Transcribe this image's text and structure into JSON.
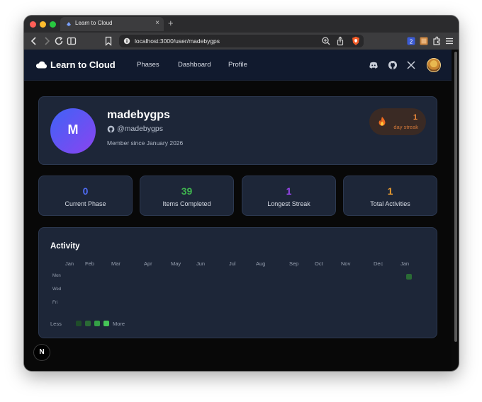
{
  "browser": {
    "tab_title": "Learn to Cloud",
    "tab_close": "×",
    "new_tab": "+",
    "url": "localhost:3000/user/madebygps"
  },
  "nav": {
    "brand": "Learn to Cloud",
    "links": [
      "Phases",
      "Dashboard",
      "Profile"
    ],
    "icons": [
      "discord-icon",
      "github-icon",
      "x-icon"
    ]
  },
  "profile": {
    "avatar_letter": "M",
    "name": "madebygps",
    "handle": "@madebygps",
    "member_since": "Member since January 2026",
    "streak": {
      "value": "1",
      "label": "day streak"
    }
  },
  "stats": [
    {
      "value": "0",
      "label": "Current Phase",
      "color": "#4f6cf5"
    },
    {
      "value": "39",
      "label": "Items Completed",
      "color": "#3fb34f"
    },
    {
      "value": "1",
      "label": "Longest Streak",
      "color": "#9a46ef"
    },
    {
      "value": "1",
      "label": "Total Activities",
      "color": "#e89a2f"
    }
  ],
  "activity": {
    "title": "Activity",
    "months": [
      "Jan",
      "Feb",
      "Mar",
      "Apr",
      "May",
      "Jun",
      "Jul",
      "Aug",
      "Sep",
      "Oct",
      "Nov",
      "Dec",
      "Jan"
    ],
    "days": [
      "Mon",
      "Wed",
      "Fri"
    ],
    "active_cells": [
      {
        "month": "Jan",
        "day": "Mon",
        "level": 1
      }
    ],
    "legend_less": "Less",
    "legend_more": "More",
    "legend_colors": [
      "#1f4d2a",
      "#2a6b35",
      "#34a146",
      "#45c557"
    ]
  },
  "dev_badge": "N"
}
